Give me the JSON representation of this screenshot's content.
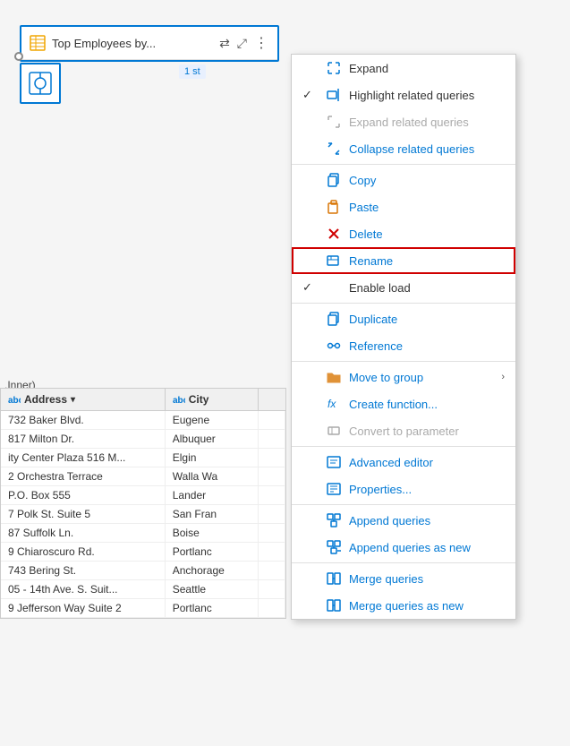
{
  "canvas": {
    "background": "#f0f0f0"
  },
  "query_card": {
    "title": "Top Employees by...",
    "step_badge": "1 st",
    "share_icon": "⇄",
    "expand_icon": "⤢",
    "more_icon": "⋮"
  },
  "table": {
    "label": ".Inner)",
    "headers": [
      {
        "label": "Address",
        "has_dropdown": true,
        "icon": "abc"
      },
      {
        "label": "City",
        "has_dropdown": false,
        "icon": "abc"
      }
    ],
    "rows": [
      {
        "address": "732 Baker Blvd.",
        "city": "Eugene"
      },
      {
        "address": "817 Milton Dr.",
        "city": "Albuquer"
      },
      {
        "address": "ity Center Plaza 516 M...",
        "city": "Elgin"
      },
      {
        "address": "2 Orchestra Terrace",
        "city": "Walla Wa"
      },
      {
        "address": "P.O. Box 555",
        "city": "Lander"
      },
      {
        "address": "7 Polk St. Suite 5",
        "city": "San Fran"
      },
      {
        "address": "87 Suffolk Ln.",
        "city": "Boise"
      },
      {
        "address": "9 Chiaroscuro Rd.",
        "city": "Portlanc"
      },
      {
        "address": "743 Bering St.",
        "city": "Anchorage"
      },
      {
        "address": "05 - 14th Ave. S. Suit...",
        "city": "Seattle"
      },
      {
        "address": "9 Jefferson Way Suite 2",
        "city": "Portlanc"
      }
    ]
  },
  "context_menu": {
    "items": [
      {
        "id": "expand",
        "label": "Expand",
        "icon": "expand",
        "check": "",
        "has_arrow": false,
        "disabled": false,
        "highlighted": false
      },
      {
        "id": "highlight-related",
        "label": "Highlight related queries",
        "icon": "highlight",
        "check": "✓",
        "has_arrow": false,
        "disabled": false,
        "highlighted": false
      },
      {
        "id": "expand-related",
        "label": "Expand related queries",
        "icon": "expand2",
        "check": "",
        "has_arrow": false,
        "disabled": true,
        "highlighted": false
      },
      {
        "id": "collapse-related",
        "label": "Collapse related queries",
        "icon": "collapse",
        "check": "",
        "has_arrow": false,
        "disabled": false,
        "highlighted": false
      },
      {
        "id": "sep1",
        "type": "separator"
      },
      {
        "id": "copy",
        "label": "Copy",
        "icon": "copy",
        "check": "",
        "has_arrow": false,
        "disabled": false,
        "highlighted": false
      },
      {
        "id": "paste",
        "label": "Paste",
        "icon": "paste",
        "check": "",
        "has_arrow": false,
        "disabled": false,
        "highlighted": false
      },
      {
        "id": "delete",
        "label": "Delete",
        "icon": "delete",
        "check": "",
        "has_arrow": false,
        "disabled": false,
        "highlighted": false
      },
      {
        "id": "rename",
        "label": "Rename",
        "icon": "rename",
        "check": "",
        "has_arrow": false,
        "disabled": false,
        "highlighted": true
      },
      {
        "id": "enable-load",
        "label": "Enable load",
        "icon": "",
        "check": "✓",
        "has_arrow": false,
        "disabled": false,
        "highlighted": false
      },
      {
        "id": "sep2",
        "type": "separator"
      },
      {
        "id": "duplicate",
        "label": "Duplicate",
        "icon": "duplicate",
        "check": "",
        "has_arrow": false,
        "disabled": false,
        "highlighted": false
      },
      {
        "id": "reference",
        "label": "Reference",
        "icon": "reference",
        "check": "",
        "has_arrow": false,
        "disabled": false,
        "highlighted": false
      },
      {
        "id": "sep3",
        "type": "separator"
      },
      {
        "id": "move-to-group",
        "label": "Move to group",
        "icon": "folder",
        "check": "",
        "has_arrow": true,
        "disabled": false,
        "highlighted": false
      },
      {
        "id": "create-function",
        "label": "Create function...",
        "icon": "fx",
        "check": "",
        "has_arrow": false,
        "disabled": false,
        "highlighted": false
      },
      {
        "id": "convert-param",
        "label": "Convert to parameter",
        "icon": "param",
        "check": "",
        "has_arrow": false,
        "disabled": true,
        "highlighted": false
      },
      {
        "id": "sep4",
        "type": "separator"
      },
      {
        "id": "advanced-editor",
        "label": "Advanced editor",
        "icon": "editor",
        "check": "",
        "has_arrow": false,
        "disabled": false,
        "highlighted": false
      },
      {
        "id": "properties",
        "label": "Properties...",
        "icon": "properties",
        "check": "",
        "has_arrow": false,
        "disabled": false,
        "highlighted": false
      },
      {
        "id": "sep5",
        "type": "separator"
      },
      {
        "id": "append-queries",
        "label": "Append queries",
        "icon": "append",
        "check": "",
        "has_arrow": false,
        "disabled": false,
        "highlighted": false
      },
      {
        "id": "append-queries-new",
        "label": "Append queries as new",
        "icon": "append2",
        "check": "",
        "has_arrow": false,
        "disabled": false,
        "highlighted": false
      },
      {
        "id": "sep6",
        "type": "separator"
      },
      {
        "id": "merge-queries",
        "label": "Merge queries",
        "icon": "merge",
        "check": "",
        "has_arrow": false,
        "disabled": false,
        "highlighted": false
      },
      {
        "id": "merge-queries-new",
        "label": "Merge queries as new",
        "icon": "merge2",
        "check": "",
        "has_arrow": false,
        "disabled": false,
        "highlighted": false
      }
    ]
  }
}
